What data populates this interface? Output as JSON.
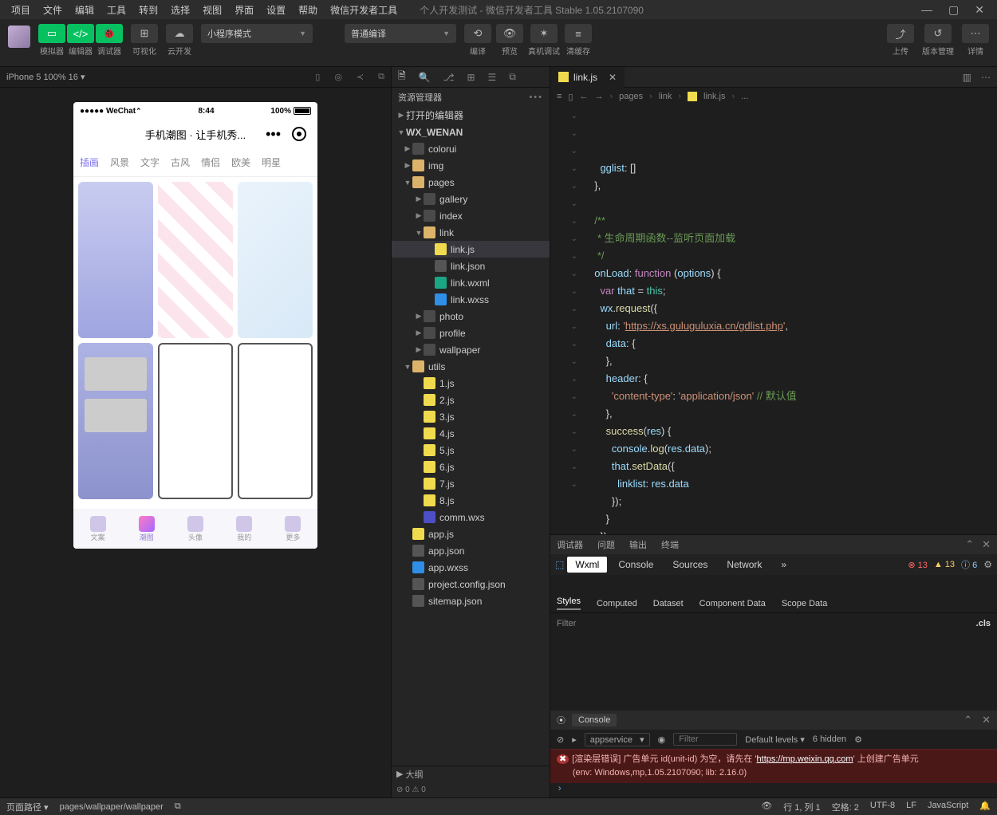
{
  "menu": [
    "项目",
    "文件",
    "编辑",
    "工具",
    "转到",
    "选择",
    "视图",
    "界面",
    "设置",
    "帮助",
    "微信开发者工具"
  ],
  "window_title": "个人开发测试 - 微信开发者工具 Stable 1.05.2107090",
  "toolbar": {
    "groups": [
      {
        "labels": [
          "模拟器",
          "编辑器",
          "调试器"
        ]
      },
      {
        "labels": [
          "可视化"
        ]
      },
      {
        "labels": [
          "云开发"
        ]
      }
    ],
    "mode_dd": "小程序模式",
    "compile_dd": "普通编译",
    "center_icons": [
      {
        "glyph": "⟲",
        "label": "编译"
      },
      {
        "glyph": "👁",
        "label": "预览"
      },
      {
        "glyph": "✶",
        "label": "真机调试"
      },
      {
        "glyph": "≡",
        "label": "清缓存"
      }
    ],
    "right_icons": [
      {
        "glyph": "⤴",
        "label": "上传"
      },
      {
        "glyph": "↺",
        "label": "版本管理"
      },
      {
        "glyph": "⋯",
        "label": "详情"
      }
    ]
  },
  "simulator": {
    "device_info": "iPhone 5 100% 16 ▾",
    "status": {
      "left": "●●●●● WeChat",
      "time": "8:44",
      "right": "100%"
    },
    "page_title": "手机潮图 · 让手机秀...",
    "tabs": [
      "插画",
      "风景",
      "文字",
      "古风",
      "情侣",
      "欧美",
      "明星"
    ],
    "bottom": [
      "文案",
      "潮图",
      "头像",
      "我的",
      "更多"
    ]
  },
  "explorer": {
    "title": "资源管理器",
    "sections": {
      "opened": "打开的编辑器",
      "project": "WX_WENAN",
      "outline": "大纲"
    },
    "tree": [
      {
        "d": 0,
        "t": "folder",
        "n": "colorui",
        "tw": "▶"
      },
      {
        "d": 0,
        "t": "ofolder",
        "n": "img",
        "tw": "▶"
      },
      {
        "d": 0,
        "t": "ofolder",
        "n": "pages",
        "tw": "▼"
      },
      {
        "d": 1,
        "t": "folder",
        "n": "gallery",
        "tw": "▶"
      },
      {
        "d": 1,
        "t": "folder",
        "n": "index",
        "tw": "▶"
      },
      {
        "d": 1,
        "t": "ofolder",
        "n": "link",
        "tw": "▼"
      },
      {
        "d": 2,
        "t": "js",
        "n": "link.js",
        "sel": true
      },
      {
        "d": 2,
        "t": "json",
        "n": "link.json"
      },
      {
        "d": 2,
        "t": "wxml",
        "n": "link.wxml"
      },
      {
        "d": 2,
        "t": "wxss",
        "n": "link.wxss"
      },
      {
        "d": 1,
        "t": "folder",
        "n": "photo",
        "tw": "▶"
      },
      {
        "d": 1,
        "t": "folder",
        "n": "profile",
        "tw": "▶"
      },
      {
        "d": 1,
        "t": "folder",
        "n": "wallpaper",
        "tw": "▶"
      },
      {
        "d": 0,
        "t": "ofolder",
        "n": "utils",
        "tw": "▼"
      },
      {
        "d": 1,
        "t": "js",
        "n": "1.js"
      },
      {
        "d": 1,
        "t": "js",
        "n": "2.js"
      },
      {
        "d": 1,
        "t": "js",
        "n": "3.js"
      },
      {
        "d": 1,
        "t": "js",
        "n": "4.js"
      },
      {
        "d": 1,
        "t": "js",
        "n": "5.js"
      },
      {
        "d": 1,
        "t": "js",
        "n": "6.js"
      },
      {
        "d": 1,
        "t": "js",
        "n": "7.js"
      },
      {
        "d": 1,
        "t": "js",
        "n": "8.js"
      },
      {
        "d": 1,
        "t": "wxs",
        "n": "comm.wxs"
      },
      {
        "d": 0,
        "t": "js",
        "n": "app.js"
      },
      {
        "d": 0,
        "t": "json",
        "n": "app.json"
      },
      {
        "d": 0,
        "t": "wxss",
        "n": "app.wxss"
      },
      {
        "d": 0,
        "t": "json",
        "n": "project.config.json"
      },
      {
        "d": 0,
        "t": "json",
        "n": "sitemap.json"
      }
    ],
    "foot": "⊘ 0 ⚠ 0"
  },
  "editor": {
    "tab": "link.js",
    "breadcrumb": [
      "pages",
      "link",
      "link.js",
      "..."
    ],
    "code_lines": [
      "    <span class='c-pr'>gglist</span>: []",
      "  },",
      "",
      "  <span class='c-cm'>/**</span>",
      "  <span class='c-cm'> * 生命周期函数--监听页面加载</span>",
      "  <span class='c-cm'> */</span>",
      "  <span class='c-pr'>onLoad</span>: <span class='c-kw'>function</span> (<span class='c-pr'>options</span>) {",
      "    <span class='c-kw'>var</span> <span class='c-pr'>that</span> = <span class='c-th'>this</span>;",
      "    <span class='c-pr'>wx</span>.<span class='c-fn'>request</span>({",
      "      <span class='c-pr'>url</span>: <span class='c-str'>'</span><span class='c-url'>https://xs.guluguluxia.cn/gdlist.php</span><span class='c-str'>'</span>,",
      "      <span class='c-pr'>data</span>: {",
      "      },",
      "      <span class='c-pr'>header</span>: {",
      "        <span class='c-str'>'content-type'</span>: <span class='c-str'>'application/json'</span> <span class='c-cm'>// 默认值</span>",
      "      },",
      "      <span class='c-fn'>success</span>(<span class='c-pr'>res</span>) {",
      "        <span class='c-pr'>console</span>.<span class='c-fn'>log</span>(<span class='c-pr'>res</span>.<span class='c-pr'>data</span>);",
      "        <span class='c-pr'>that</span>.<span class='c-fn'>setData</span>({",
      "          <span class='c-pr'>linklist</span>: <span class='c-pr'>res</span>.<span class='c-pr'>data</span>",
      "        });",
      "      }",
      "    })"
    ]
  },
  "devtools": {
    "row1": [
      "调试器",
      "问题",
      "输出",
      "终端"
    ],
    "row2": [
      "Wxml",
      "Console",
      "Sources",
      "Network",
      "»"
    ],
    "badges": {
      "err": "13",
      "warn": "13",
      "info": "6"
    },
    "row3": [
      "Styles",
      "Computed",
      "Dataset",
      "Component Data",
      "Scope Data"
    ],
    "filter": "Filter",
    "cls": ".cls",
    "console_tab": "Console",
    "con_ctx": "appservice",
    "con_filter": "Filter",
    "con_levels": "Default levels ▾",
    "con_hidden": "6 hidden",
    "err_line1_a": "[渲染层错误] 广告单元 id(unit-id) 为空，请先在 '",
    "err_line1_link": "https://mp.weixin.qq.com",
    "err_line1_b": "' 上创建广告单元",
    "err_line2": "(env: Windows,mp,1.05.2107090; lib: 2.16.0)"
  },
  "status": {
    "left": [
      "页面路径 ▾",
      "pages/wallpaper/wallpaper"
    ],
    "right": [
      "行 1, 列 1",
      "空格: 2",
      "UTF-8",
      "LF",
      "JavaScript"
    ]
  }
}
